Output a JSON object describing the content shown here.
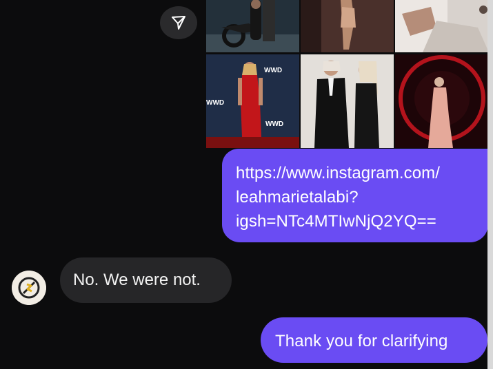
{
  "conversation": {
    "share_icon": "paper-plane-icon",
    "photo_grid": {
      "tiles": [
        {
          "name": "photo-man-motorcycle"
        },
        {
          "name": "photo-woman-pose"
        },
        {
          "name": "photo-woman-white-room"
        },
        {
          "name": "photo-red-dress-wwd",
          "text": [
            "WWD",
            "WWD",
            "WWD"
          ]
        },
        {
          "name": "photo-two-women-black-outfits"
        },
        {
          "name": "photo-pink-dress-red-backdrop"
        }
      ]
    },
    "messages": [
      {
        "direction": "outgoing",
        "lines": [
          "https://www.instagram.com/",
          "leahmarietalabi?",
          "igsh=NTc4MTIwNjQ2YQ=="
        ]
      },
      {
        "direction": "incoming",
        "text": "No. We were not."
      },
      {
        "direction": "outgoing",
        "text": "Thank you for clarifying"
      }
    ],
    "colors": {
      "background": "#0c0c0d",
      "outgoing_bubble": "#6a4cf3",
      "incoming_bubble": "#262628",
      "share_button": "#2a2a2c"
    }
  }
}
